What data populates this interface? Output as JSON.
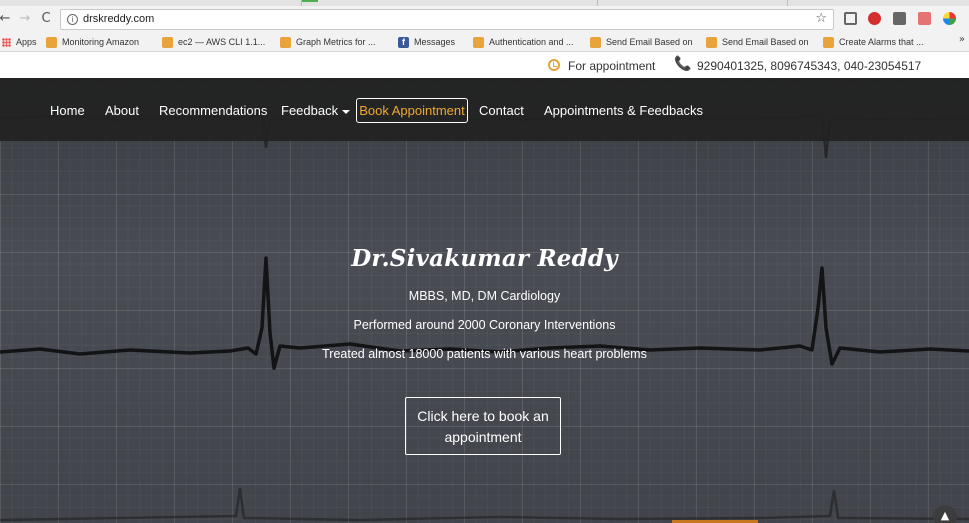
{
  "browser": {
    "url": "drskreddy.com",
    "nav": {
      "back": "←",
      "forward": "→",
      "reload": "C"
    },
    "info_icon": "i",
    "star_icon": "☆",
    "bookmarks": [
      {
        "label": "Apps",
        "icon": "apps-icon"
      },
      {
        "label": "Monitoring Amazon",
        "icon": "box-icon"
      },
      {
        "label": "ec2 — AWS CLI 1.1...",
        "icon": "box-icon"
      },
      {
        "label": "Graph Metrics for ...",
        "icon": "box-icon"
      },
      {
        "label": "Messages",
        "icon": "facebook-icon"
      },
      {
        "label": "Authentication and ...",
        "icon": "box-icon"
      },
      {
        "label": "Send Email Based on",
        "icon": "box-icon"
      },
      {
        "label": "Send Email Based on",
        "icon": "box-icon"
      },
      {
        "label": "Create Alarms that ...",
        "icon": "box-icon"
      }
    ],
    "more": "»",
    "fb_glyph": "f"
  },
  "topbar": {
    "appointment_label": "For appointment",
    "phones": "9290401325, 8096745343, 040-23054517",
    "phone_glyph": "📞"
  },
  "navbar": {
    "items": [
      {
        "label": "Home"
      },
      {
        "label": "About"
      },
      {
        "label": "Recommendations"
      },
      {
        "label": "Feedback"
      },
      {
        "label": "Book Appointment"
      },
      {
        "label": "Contact"
      },
      {
        "label": "Appointments & Feedbacks"
      }
    ]
  },
  "hero": {
    "name": "Dr.Sivakumar Reddy",
    "qualifications": "MBBS, MD, DM Cardiology",
    "line2": "Performed around 2000 Coronary Interventions",
    "line3": "Treated almost 18000 patients with various heart problems",
    "cta_line1": "Click here to book an",
    "cta_line2": "appointment",
    "scroll_glyph": "▲"
  },
  "colors": {
    "accent": "#f0a830",
    "navbar": "#222222",
    "hero_bg": "#4d5058"
  }
}
